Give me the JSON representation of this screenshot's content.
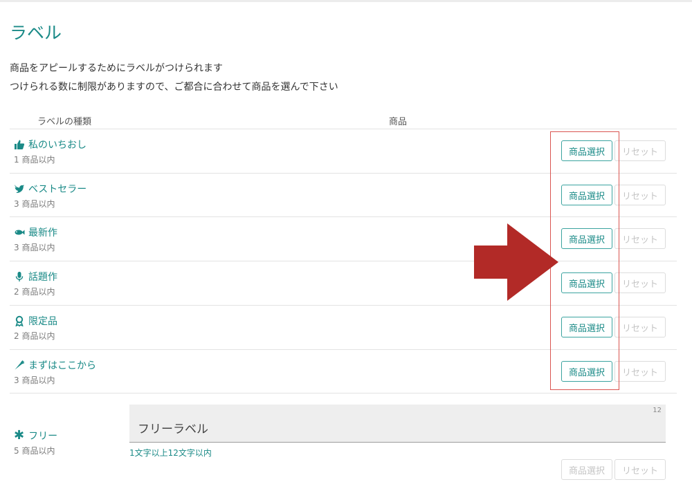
{
  "page": {
    "title": "ラベル",
    "description": [
      "商品をアピールするためにラベルがつけられます",
      "つけられる数に制限がありますので、ご都合に合わせて商品を選んで下さい"
    ]
  },
  "table": {
    "headers": {
      "kind": "ラベルの種類",
      "product": "商品"
    },
    "rows": [
      {
        "name": "私のいちおし",
        "limit": "1 商品以内",
        "icon": "thumbs-up-icon",
        "select": "商品選択",
        "reset": "リセット"
      },
      {
        "name": "ベストセラー",
        "limit": "3 商品以内",
        "icon": "bird-icon",
        "select": "商品選択",
        "reset": "リセット"
      },
      {
        "name": "最新作",
        "limit": "3 商品以内",
        "icon": "fish-icon",
        "select": "商品選択",
        "reset": "リセット"
      },
      {
        "name": "話題作",
        "limit": "2 商品以内",
        "icon": "microphone-icon",
        "select": "商品選択",
        "reset": "リセット"
      },
      {
        "name": "限定品",
        "limit": "2 商品以内",
        "icon": "ribbon-award-icon",
        "select": "商品選択",
        "reset": "リセット"
      },
      {
        "name": "まずはここから",
        "limit": "3 商品以内",
        "icon": "carrot-icon",
        "select": "商品選択",
        "reset": "リセット"
      }
    ]
  },
  "free": {
    "name": "フリー",
    "limit": "5 商品以内",
    "icon": "asterisk-icon",
    "input_value": "フリーラベル",
    "char_count": "12",
    "help": "1文字以上12文字以内",
    "select": "商品選択",
    "reset": "リセット"
  },
  "colors": {
    "accent": "#1a8a87",
    "highlight_box": "#d9534f",
    "arrow": "#b22a27"
  }
}
